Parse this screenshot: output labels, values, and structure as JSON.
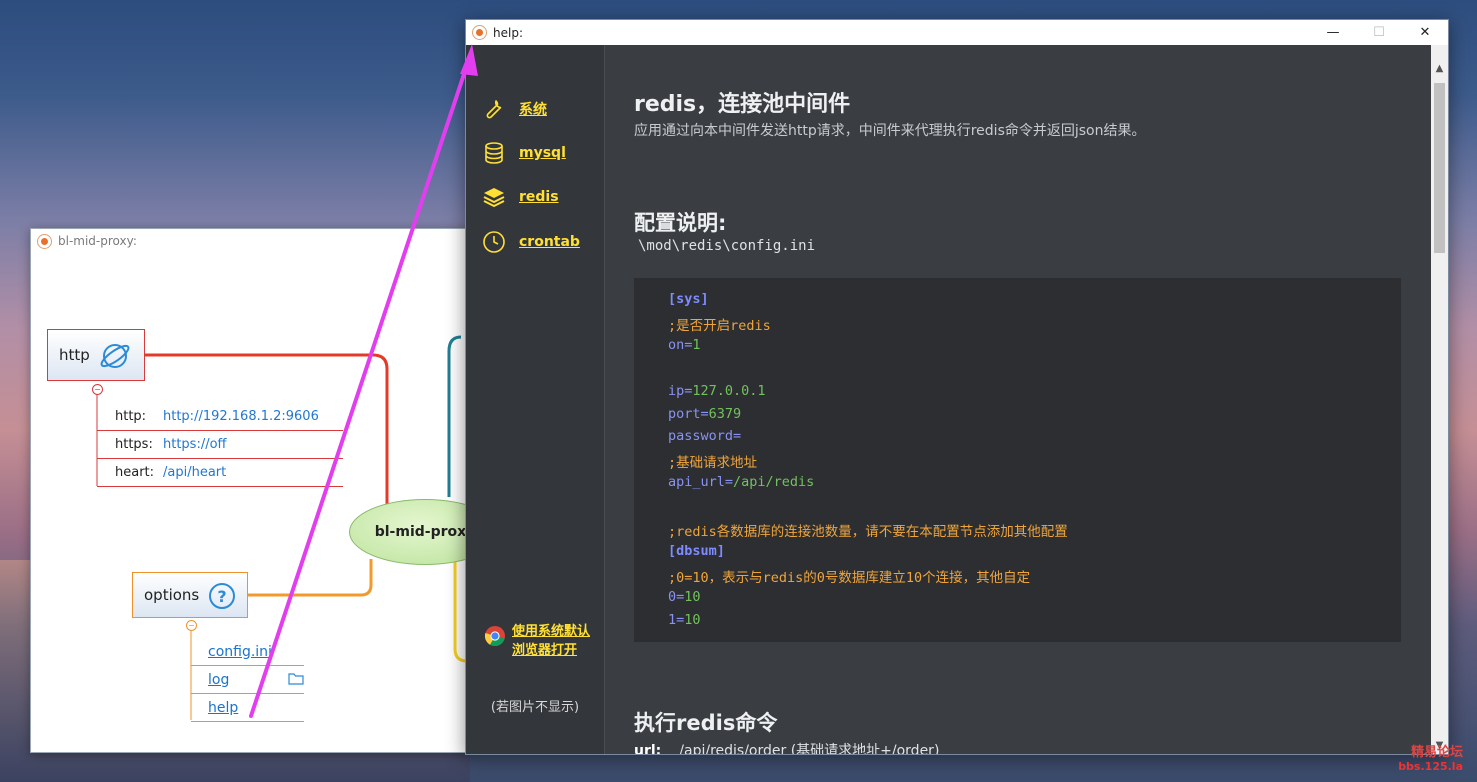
{
  "back_window": {
    "title": "bl-mid-proxy:",
    "center_node": "bl-mid-proxy",
    "http_node": {
      "label": "http",
      "rows": [
        {
          "key": "http:",
          "value": "http://192.168.1.2:9606"
        },
        {
          "key": "https:",
          "value": "https://off"
        },
        {
          "key": "heart:",
          "value": "/api/heart"
        }
      ]
    },
    "options_node": {
      "label": "options",
      "links": [
        "config.ini",
        "log",
        "help"
      ]
    }
  },
  "help_window": {
    "title": "help:",
    "sidebar": {
      "items": [
        {
          "label": "系统",
          "icon": "wrench-icon"
        },
        {
          "label": "mysql",
          "icon": "database-icon"
        },
        {
          "label": "redis",
          "icon": "layers-icon"
        },
        {
          "label": "crontab",
          "icon": "clock-icon"
        }
      ],
      "open_browser_line1": "使用系统默认",
      "open_browser_line2": "浏览器打开",
      "image_note": "(若图片不显示)"
    },
    "content": {
      "heading": "redis，连接池中间件",
      "description": "应用通过向本中间件发送http请求，中间件来代理执行redis命令并返回json结果。",
      "config_heading": "配置说明:",
      "config_path": "\\mod\\redis\\config.ini",
      "code_lines": [
        {
          "t": "section",
          "text": "[sys]"
        },
        {
          "t": "comment",
          "text": ";是否开启redis"
        },
        {
          "t": "kv",
          "key": "on=",
          "val": "1"
        },
        {
          "t": "blank",
          "text": ""
        },
        {
          "t": "kv",
          "key": "ip=",
          "val": "127.0.0.1"
        },
        {
          "t": "kv",
          "key": "port=",
          "val": "6379"
        },
        {
          "t": "kv",
          "key": "password=",
          "val": ""
        },
        {
          "t": "comment",
          "text": ";基础请求地址"
        },
        {
          "t": "kv",
          "key": "api_url=",
          "val": "/api/redis"
        },
        {
          "t": "blank",
          "text": ""
        },
        {
          "t": "comment",
          "text": ";redis各数据库的连接池数量，请不要在本配置节点添加其他配置"
        },
        {
          "t": "section",
          "text": "[dbsum]"
        },
        {
          "t": "comment",
          "text": ";0=10，表示与redis的0号数据库建立10个连接，其他自定"
        },
        {
          "t": "kv",
          "key": "0=",
          "val": "10"
        },
        {
          "t": "kv",
          "key": "1=",
          "val": "10"
        }
      ],
      "exec_heading": "执行redis命令",
      "url_label": "url:",
      "url_value": "/api/redis/order  (基础请求地址+/order)"
    }
  },
  "watermark": {
    "line1": "精易论坛",
    "line2": "bbs.125.la"
  },
  "colors": {
    "accent_yellow": "#ffe033",
    "arrow_magenta": "#e23ef0"
  }
}
